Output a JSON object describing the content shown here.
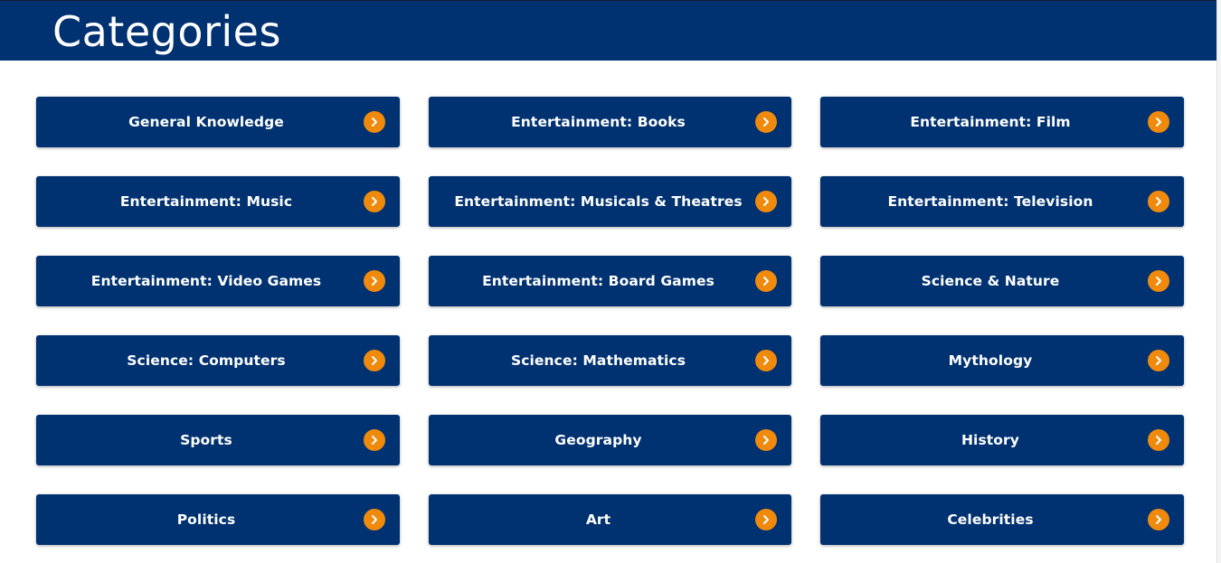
{
  "header": {
    "title": "Categories"
  },
  "colors": {
    "header_bg": "#003170",
    "button_bg": "#003170",
    "arrow_accent": "#f08a0c",
    "text": "#ffffff"
  },
  "categories": [
    {
      "label": "General Knowledge",
      "icon": "chevron-right-icon"
    },
    {
      "label": "Entertainment: Books",
      "icon": "chevron-right-icon"
    },
    {
      "label": "Entertainment: Film",
      "icon": "chevron-right-icon"
    },
    {
      "label": "Entertainment: Music",
      "icon": "chevron-right-icon"
    },
    {
      "label": "Entertainment: Musicals & Theatres",
      "icon": "chevron-right-icon"
    },
    {
      "label": "Entertainment: Television",
      "icon": "chevron-right-icon"
    },
    {
      "label": "Entertainment: Video Games",
      "icon": "chevron-right-icon"
    },
    {
      "label": "Entertainment: Board Games",
      "icon": "chevron-right-icon"
    },
    {
      "label": "Science & Nature",
      "icon": "chevron-right-icon"
    },
    {
      "label": "Science: Computers",
      "icon": "chevron-right-icon"
    },
    {
      "label": "Science: Mathematics",
      "icon": "chevron-right-icon"
    },
    {
      "label": "Mythology",
      "icon": "chevron-right-icon"
    },
    {
      "label": "Sports",
      "icon": "chevron-right-icon"
    },
    {
      "label": "Geography",
      "icon": "chevron-right-icon"
    },
    {
      "label": "History",
      "icon": "chevron-right-icon"
    },
    {
      "label": "Politics",
      "icon": "chevron-right-icon"
    },
    {
      "label": "Art",
      "icon": "chevron-right-icon"
    },
    {
      "label": "Celebrities",
      "icon": "chevron-right-icon"
    }
  ]
}
